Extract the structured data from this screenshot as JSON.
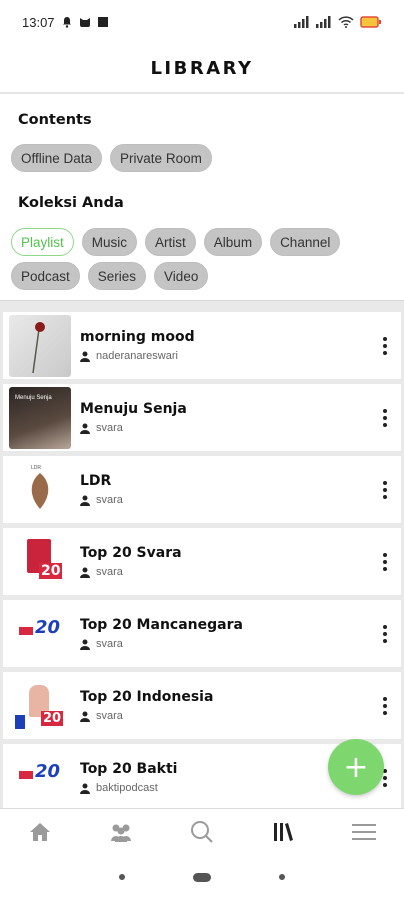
{
  "status_bar": {
    "time": "13:07"
  },
  "header": {
    "title": "LIBRARY"
  },
  "contents": {
    "title": "Contents",
    "chips": [
      "Offline Data",
      "Private Room"
    ]
  },
  "collection": {
    "title": "Koleksi Anda",
    "chips_row1": [
      "Playlist",
      "Music",
      "Artist",
      "Album",
      "Channel"
    ],
    "chips_row2": [
      "Podcast",
      "Series",
      "Video"
    ],
    "active_chip": "Playlist"
  },
  "items": [
    {
      "title": "morning mood",
      "owner": "naderanareswari"
    },
    {
      "title": "Menuju Senja",
      "owner": "svara",
      "thumb_text": "Menuju Senja"
    },
    {
      "title": "LDR",
      "owner": "svara",
      "thumb_text": "LDR"
    },
    {
      "title": "Top 20 Svara",
      "owner": "svara",
      "thumb_text": "20"
    },
    {
      "title": "Top 20 Mancanegara",
      "owner": "svara",
      "thumb_text": "20"
    },
    {
      "title": "Top 20 Indonesia",
      "owner": "svara",
      "thumb_text": "20"
    },
    {
      "title": "Top 20 Bakti",
      "owner": "baktipodcast",
      "thumb_text": "20"
    }
  ],
  "fab": {
    "label": "+"
  },
  "colors": {
    "accent": "#7ed66f",
    "chip_bg": "#c4c4c4",
    "active_chip_text": "#53c24d"
  }
}
